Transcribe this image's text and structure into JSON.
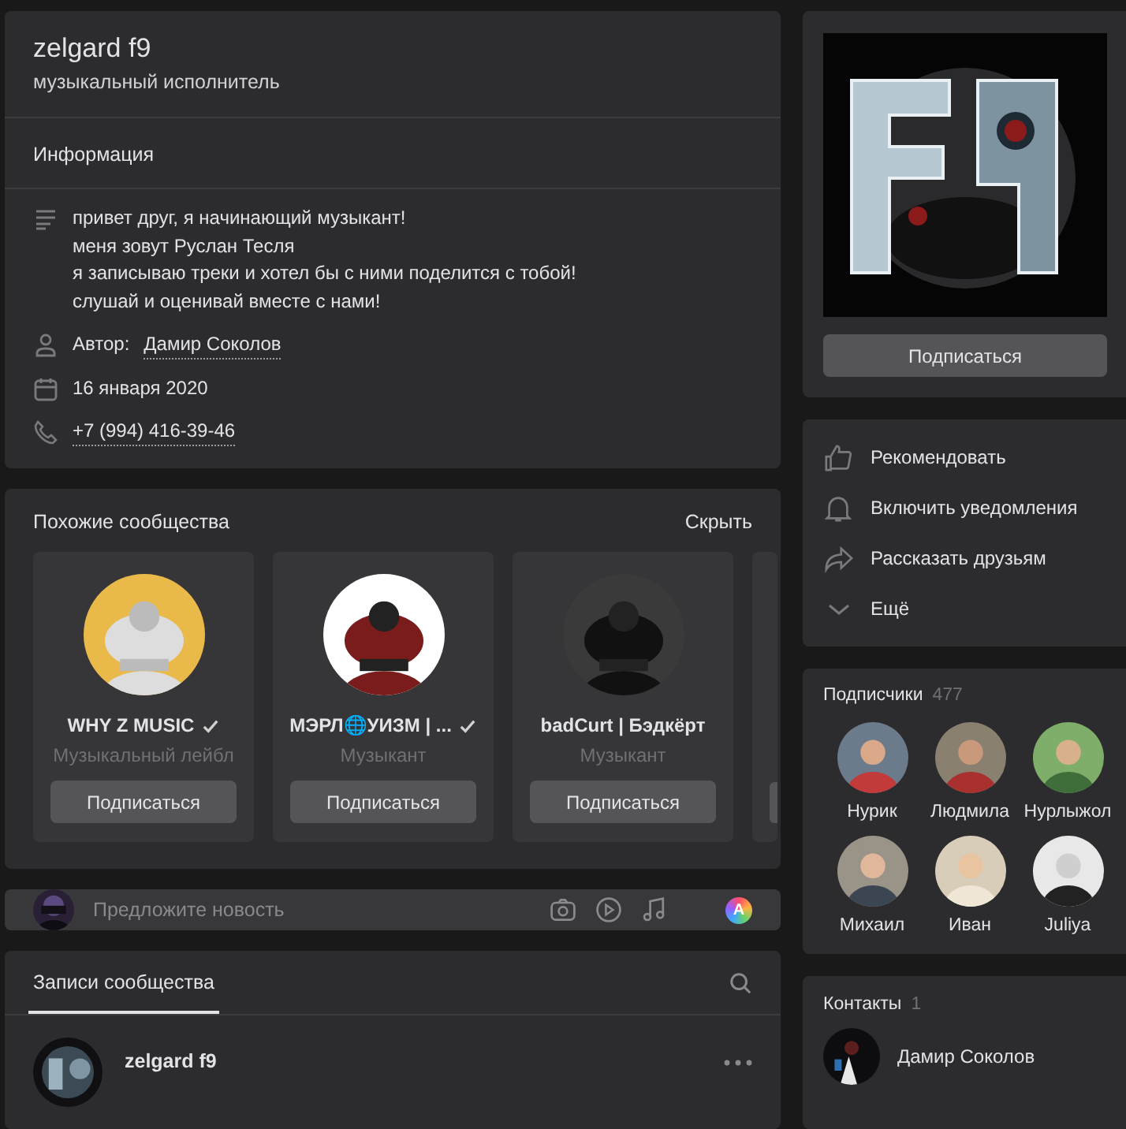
{
  "header": {
    "name": "zelgard f9",
    "status": "музыкальный исполнитель"
  },
  "info": {
    "title": "Информация",
    "description": "привет друг, я начинающий музыкант!\nменя зовут Руслан Тесля\nя записываю треки и хотел бы с ними поделится с тобой!\nслушай и оценивай вместе с нами!",
    "details": [
      {
        "kind": "author",
        "label": "Автор:",
        "link": "Дамир Соколов"
      },
      {
        "kind": "date",
        "text": "16 января 2020"
      },
      {
        "kind": "phone",
        "link": "+7 (994) 416-39-46"
      }
    ]
  },
  "similar": {
    "title": "Похожие сообщества",
    "hide": "Скрыть",
    "communities": [
      {
        "name": "WHY Z MUSIC",
        "verified": true,
        "category": "Музыкальный лейбл",
        "button": "Подписаться"
      },
      {
        "name": "МЭРЛ🌐УИЗМ | ...",
        "verified": true,
        "category": "Музыкант",
        "button": "Подписаться"
      },
      {
        "name": "badCurt | Бэдкёрт",
        "verified": false,
        "category": "Музыкант",
        "button": "Подписаться"
      }
    ]
  },
  "suggest": {
    "placeholder": "Предложите новость",
    "badge": "A"
  },
  "posts": {
    "tabs": [
      {
        "label": "Записи сообщества",
        "selected": true
      }
    ],
    "items": [
      {
        "author": "zelgard f9"
      }
    ]
  },
  "profile": {
    "button": "Подписаться"
  },
  "actions": [
    {
      "kind": "recommend",
      "label": "Рекомендовать"
    },
    {
      "kind": "notify",
      "label": "Включить уведомления"
    },
    {
      "kind": "share",
      "label": "Рассказать друзьям"
    },
    {
      "kind": "more",
      "label": "Ещё"
    }
  ],
  "followers": {
    "title": "Подписчики",
    "count": "477",
    "people": [
      {
        "name": "Нурик"
      },
      {
        "name": "Людмила"
      },
      {
        "name": "Нурлыжол"
      },
      {
        "name": "Михаил"
      },
      {
        "name": "Иван"
      },
      {
        "name": "Juliya"
      }
    ]
  },
  "contacts": {
    "title": "Контакты",
    "count": "1",
    "people": [
      {
        "name": "Дамир Соколов"
      }
    ]
  }
}
